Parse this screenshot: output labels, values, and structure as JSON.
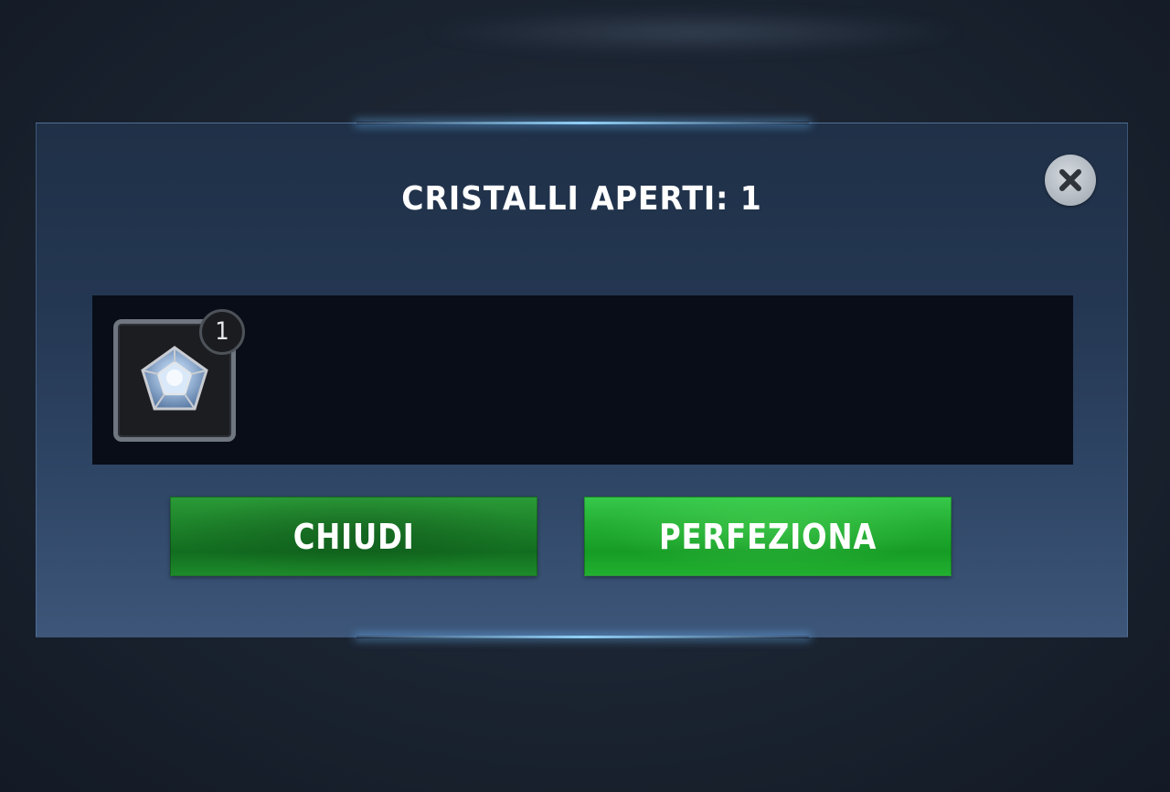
{
  "dialog": {
    "title": "CRISTALLI APERTI: 1",
    "close_icon": "close-icon"
  },
  "rewards": {
    "items": [
      {
        "icon": "crystal-icon",
        "count": "1"
      }
    ]
  },
  "buttons": {
    "close_label": "CHIUDI",
    "refine_label": "PERFEZIONA"
  },
  "colors": {
    "button_green": "#1f9a2f",
    "button_green_bright": "#24ae33",
    "panel_dark": "#080d18",
    "dialog_blue": "#243752",
    "accent_glow": "#96d7ff"
  }
}
